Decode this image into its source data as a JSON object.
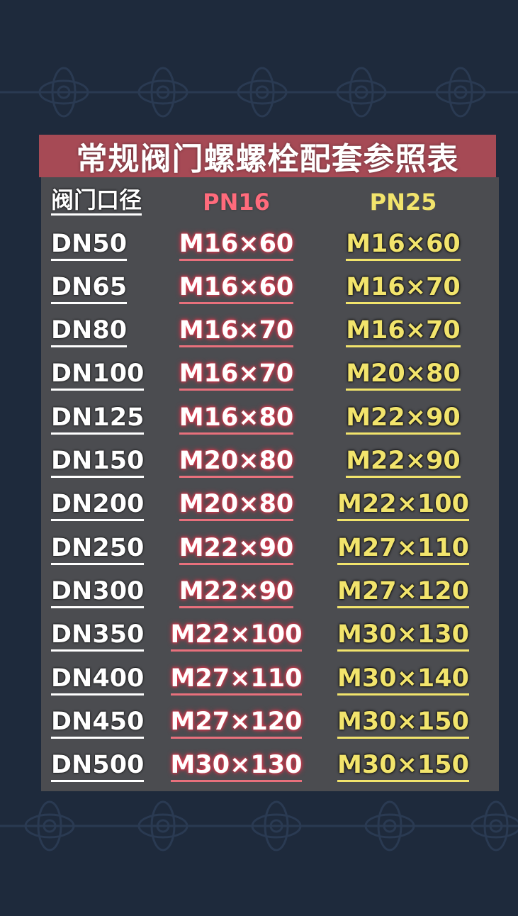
{
  "title": "常规阀门螺螺栓配套参照表",
  "table": {
    "headers": [
      "阀门口径",
      "PN16",
      "PN25"
    ],
    "rows": [
      [
        "DN50",
        "M16×60",
        "M16×60"
      ],
      [
        "DN65",
        "M16×60",
        "M16×70"
      ],
      [
        "DN80",
        "M16×70",
        "M16×70"
      ],
      [
        "DN100",
        "M16×70",
        "M20×80"
      ],
      [
        "DN125",
        "M16×80",
        "M22×90"
      ],
      [
        "DN150",
        "M20×80",
        "M22×90"
      ],
      [
        "DN200",
        "M20×80",
        "M22×100"
      ],
      [
        "DN250",
        "M22×90",
        "M27×110"
      ],
      [
        "DN300",
        "M22×90",
        "M27×120"
      ],
      [
        "DN350",
        "M22×100",
        "M30×130"
      ],
      [
        "DN400",
        "M27×110",
        "M30×140"
      ],
      [
        "DN450",
        "M27×120",
        "M30×150"
      ],
      [
        "DN500",
        "M30×130",
        "M30×150"
      ]
    ]
  },
  "colors": {
    "background": "#1e2a3c",
    "title_bg": "#a64a55",
    "panel": "#4b4c50",
    "pn16_text": "#ffffff",
    "pn16_glow": "#e8404f",
    "pn25_text": "#f2e46c"
  },
  "decoration": "dark-blue-floral-pattern"
}
